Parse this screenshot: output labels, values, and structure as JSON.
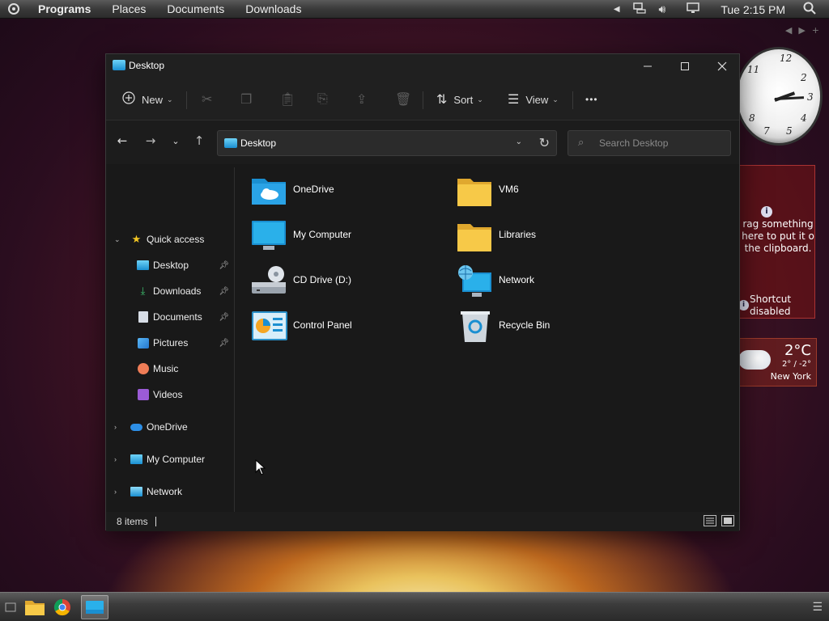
{
  "topbar": {
    "menus": [
      "Programs",
      "Places",
      "Documents",
      "Downloads"
    ],
    "clock": "Tue 2:15 PM"
  },
  "window": {
    "title": "Desktop",
    "controls": {
      "minimize": "—",
      "maximize": "☐",
      "close": "✕"
    }
  },
  "commandbar": {
    "new_label": "New",
    "sort_label": "Sort",
    "view_label": "View",
    "more_label": "•••"
  },
  "navigation": {
    "address": "Desktop",
    "search_placeholder": "Search Desktop"
  },
  "sidebar": {
    "quick_access": "Quick access",
    "pinned": [
      {
        "label": "Desktop",
        "icon": "desktop-icon",
        "pinned": true
      },
      {
        "label": "Downloads",
        "icon": "download-icon",
        "pinned": true
      },
      {
        "label": "Documents",
        "icon": "document-icon",
        "pinned": true
      },
      {
        "label": "Pictures",
        "icon": "pictures-icon",
        "pinned": true
      },
      {
        "label": "Music",
        "icon": "music-icon",
        "pinned": false
      },
      {
        "label": "Videos",
        "icon": "videos-icon",
        "pinned": false
      }
    ],
    "roots": [
      {
        "label": "OneDrive",
        "icon": "cloud-icon"
      },
      {
        "label": "My Computer",
        "icon": "computer-icon"
      },
      {
        "label": "Network",
        "icon": "network-icon"
      }
    ]
  },
  "content": {
    "items": [
      {
        "label": "OneDrive",
        "icon": "onedrive-folder-icon"
      },
      {
        "label": "VM6",
        "icon": "folder-icon"
      },
      {
        "label": "My Computer",
        "icon": "monitor-icon"
      },
      {
        "label": "Libraries",
        "icon": "folder-icon"
      },
      {
        "label": "CD Drive (D:)",
        "icon": "cd-drive-icon"
      },
      {
        "label": "Network",
        "icon": "network-globe-icon"
      },
      {
        "label": "Control Panel",
        "icon": "control-panel-icon"
      },
      {
        "label": "Recycle Bin",
        "icon": "recycle-bin-icon"
      }
    ]
  },
  "statusbar": {
    "item_count": "8 items"
  },
  "gadgets": {
    "clipboard_text": "rag something here to put it o the clipboard.",
    "shortcut_text": "Shortcut disabled",
    "weather_temp": "2°C",
    "weather_range": "2° / -2°",
    "weather_city": "New York"
  },
  "colors": {
    "window_bg": "#191919",
    "accent_blue": "#1a8fd1",
    "folder_yellow": "#f7c948"
  }
}
